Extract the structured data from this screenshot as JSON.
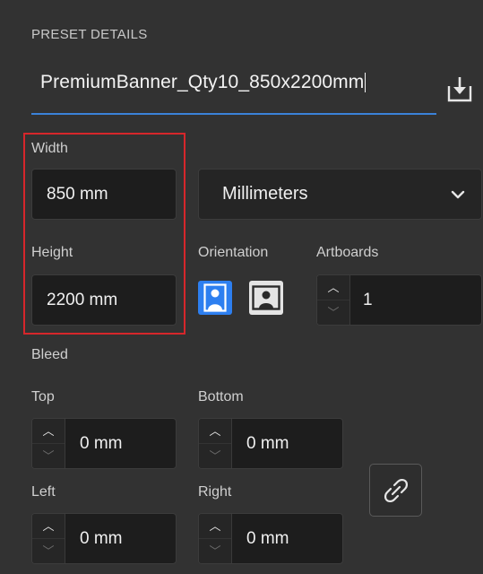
{
  "preset": {
    "section_title": "PRESET DETAILS",
    "name_value": "PremiumBanner_Qty10_850x2200mm",
    "save_icon": "save-preset-icon"
  },
  "size": {
    "width_label": "Width",
    "width_value": "850 mm",
    "height_label": "Height",
    "height_value": "2200 mm"
  },
  "units": {
    "selected": "Millimeters"
  },
  "orientation": {
    "label": "Orientation",
    "portrait_icon": "portrait-icon",
    "landscape_icon": "landscape-icon",
    "active_color": "#2d7ff0"
  },
  "artboards": {
    "label": "Artboards",
    "value": "1"
  },
  "bleed": {
    "section_title": "Bleed",
    "top_label": "Top",
    "top_value": "0 mm",
    "bottom_label": "Bottom",
    "bottom_value": "0 mm",
    "left_label": "Left",
    "left_value": "0 mm",
    "right_label": "Right",
    "right_value": "0 mm",
    "link_icon": "link-icon"
  },
  "colors": {
    "background": "#323232",
    "accent": "#3b82d9",
    "highlight_border": "#d6262b"
  }
}
